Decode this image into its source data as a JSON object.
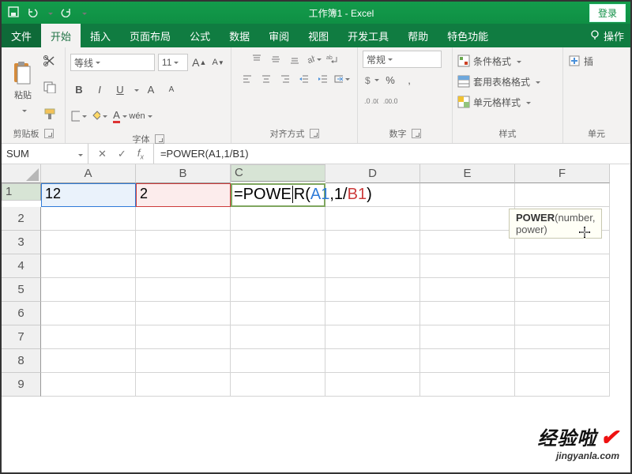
{
  "title": "工作簿1 - Excel",
  "login": "登录",
  "tabs": {
    "file": "文件",
    "home": "开始",
    "insert": "插入",
    "layout": "页面布局",
    "formulas": "公式",
    "data": "数据",
    "review": "审阅",
    "view": "视图",
    "developer": "开发工具",
    "help": "帮助",
    "special": "特色功能",
    "tell": "操作"
  },
  "ribbon": {
    "clipboard": {
      "label": "剪贴板",
      "paste": "粘贴"
    },
    "font": {
      "label": "字体",
      "name": "等线",
      "size": "11"
    },
    "align": {
      "label": "对齐方式"
    },
    "number": {
      "label": "数字",
      "format": "常规"
    },
    "styles": {
      "label": "样式",
      "cond": "条件格式",
      "table": "套用表格格式",
      "cell": "单元格样式"
    },
    "cells": {
      "label": "单元",
      "insert": "插"
    }
  },
  "fxbar": {
    "name": "SUM",
    "formula": "=POWER(A1,1/B1)"
  },
  "grid": {
    "cols": [
      "A",
      "B",
      "C",
      "D",
      "E",
      "F"
    ],
    "rows": [
      "1",
      "2",
      "3",
      "4",
      "5",
      "6",
      "7",
      "8",
      "9"
    ],
    "a1": "12",
    "b1": "2",
    "c1_prefix": "=POWE",
    "c1_mid": "R(",
    "c1_refA": "A1",
    "c1_sep": ",1/",
    "c1_refB": "B1",
    "c1_suffix": ")"
  },
  "tooltip": {
    "fn": "POWER",
    "sig": "(number, power)"
  },
  "watermark": {
    "line1": "经验啦",
    "line2": "jingyanla.com"
  }
}
